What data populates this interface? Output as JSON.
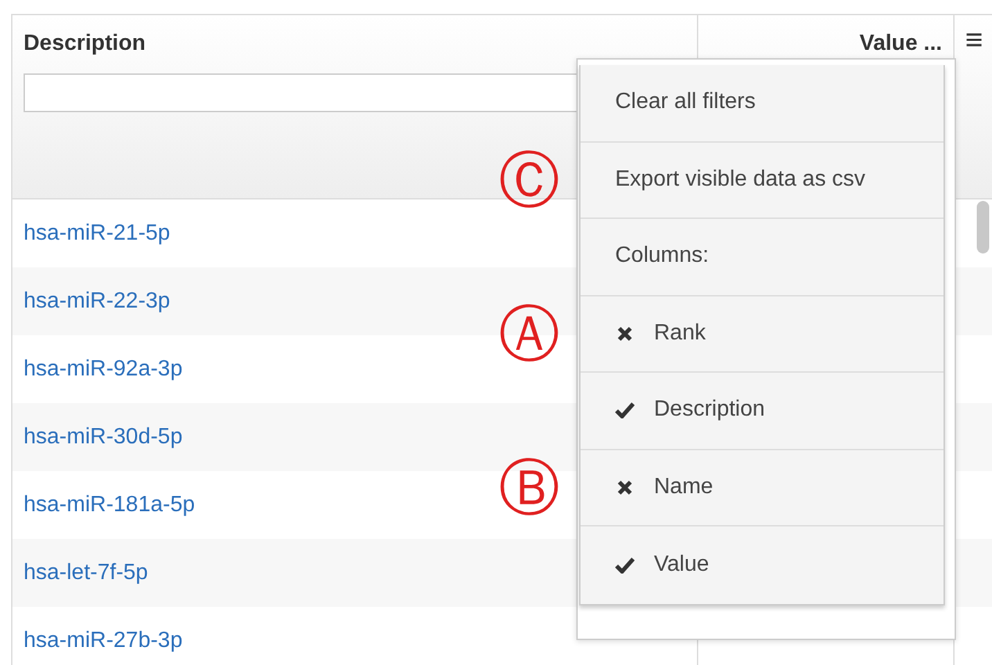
{
  "table": {
    "columns": [
      {
        "label": "Description"
      },
      {
        "label": "Value ..."
      }
    ],
    "rows": [
      {
        "description": "hsa-miR-21-5p"
      },
      {
        "description": "hsa-miR-22-3p"
      },
      {
        "description": "hsa-miR-92a-3p"
      },
      {
        "description": "hsa-miR-30d-5p"
      },
      {
        "description": "hsa-miR-181a-5p"
      },
      {
        "description": "hsa-let-7f-5p"
      },
      {
        "description": "hsa-miR-27b-3p"
      }
    ]
  },
  "menu_button": "≡",
  "menu": {
    "items": [
      {
        "kind": "action",
        "label": "Clear all filters"
      },
      {
        "kind": "action",
        "label": "Export visible data as csv",
        "marker": "Ⓒ"
      },
      {
        "kind": "header",
        "label": "Columns:"
      },
      {
        "kind": "column",
        "label": "Rank",
        "checked": false,
        "marker": "Ⓐ"
      },
      {
        "kind": "column",
        "label": "Description",
        "checked": true
      },
      {
        "kind": "column",
        "label": "Name",
        "checked": false,
        "marker": "Ⓑ"
      },
      {
        "kind": "column",
        "label": "Value",
        "checked": true
      }
    ]
  }
}
